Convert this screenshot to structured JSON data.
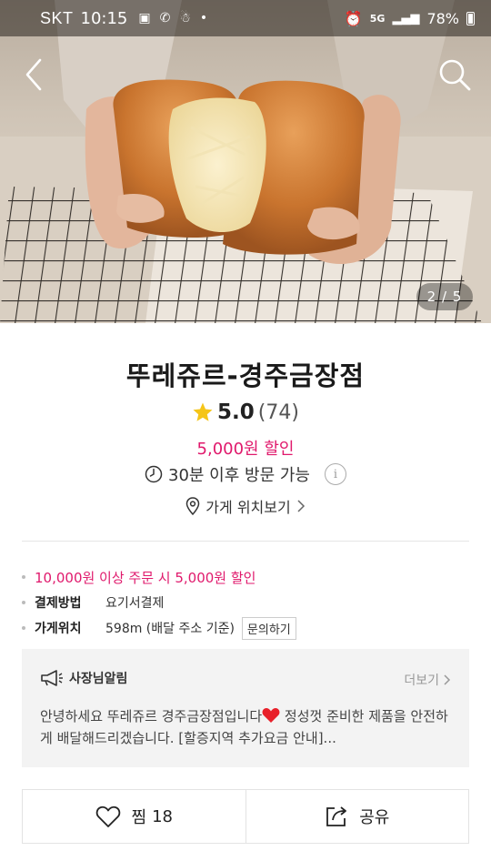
{
  "status_bar": {
    "carrier": "SKT",
    "time": "10:15",
    "battery": "78%",
    "network": "5G"
  },
  "gallery": {
    "page_indicator": "2 / 5",
    "current": 2,
    "total": 5
  },
  "store": {
    "name": "뚜레쥬르-경주금장점",
    "rating": "5.0",
    "review_count": "(74)",
    "discount": "5,000원 할인",
    "pickup": "30분 이후 방문 가능",
    "location_link": "가게 위치보기"
  },
  "details": {
    "promo": "10,000원 이상 주문 시 5,000원 할인",
    "payment_label": "결제방법",
    "payment_value": "요기서결제",
    "distance_label": "가게위치",
    "distance_value": "598m (배달 주소 기준)",
    "inquiry_button": "문의하기"
  },
  "notice": {
    "title": "사장님알림",
    "more": "더보기",
    "body_1": "안녕하세요 뚜레쥬르 경주금장점입니다",
    "body_2": " 정성껏 준비한 제품을 안전하게 배달해드리겠습니다. [할증지역 추가요금 안내]..."
  },
  "actions": {
    "favorite_label": "찜",
    "favorite_count": "18",
    "share_label": "공유"
  },
  "colors": {
    "accent": "#e0196c",
    "star": "#f5c518",
    "heart": "#e8202a"
  },
  "icons": [
    "back-arrow-icon",
    "search-icon",
    "star-icon",
    "clock-icon",
    "info-icon",
    "location-pin-icon",
    "chevron-right-icon",
    "megaphone-icon",
    "heart-icon",
    "share-icon"
  ]
}
